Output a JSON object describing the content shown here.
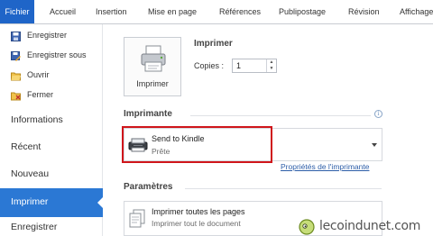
{
  "ribbon": {
    "tabs": [
      {
        "label": "Fichier",
        "active": true
      },
      {
        "label": "Accueil"
      },
      {
        "label": "Insertion"
      },
      {
        "label": "Mise en page"
      },
      {
        "label": "Références"
      },
      {
        "label": "Publipostage"
      },
      {
        "label": "Révision"
      },
      {
        "label": "Affichage"
      }
    ]
  },
  "menu": {
    "items": [
      {
        "label": "Enregistrer",
        "icon": "save-icon"
      },
      {
        "label": "Enregistrer sous",
        "icon": "save-as-icon"
      },
      {
        "label": "Ouvrir",
        "icon": "open-folder-icon"
      },
      {
        "label": "Fermer",
        "icon": "close-folder-icon"
      },
      {
        "label": "Informations"
      },
      {
        "label": "Récent"
      },
      {
        "label": "Nouveau"
      },
      {
        "label": "Imprimer",
        "active": true
      },
      {
        "label": "Enregistrer"
      }
    ]
  },
  "print": {
    "title": "Imprimer",
    "button_label": "Imprimer",
    "copies_label": "Copies :",
    "copies_value": "1"
  },
  "printer": {
    "section_title": "Imprimante",
    "name": "Send to Kindle",
    "status": "Prête",
    "properties_link": "Propriétés de l'imprimante",
    "highlight_color": "#d0161b"
  },
  "settings": {
    "section_title": "Paramètres",
    "pages_title": "Imprimer toutes les pages",
    "pages_subtitle": "Imprimer tout le document"
  },
  "watermark": {
    "text": "lecoindunet.com"
  },
  "colors": {
    "file_tab": "#1f65c8",
    "active_menu": "#2b78d4",
    "link": "#2d5ea8"
  }
}
